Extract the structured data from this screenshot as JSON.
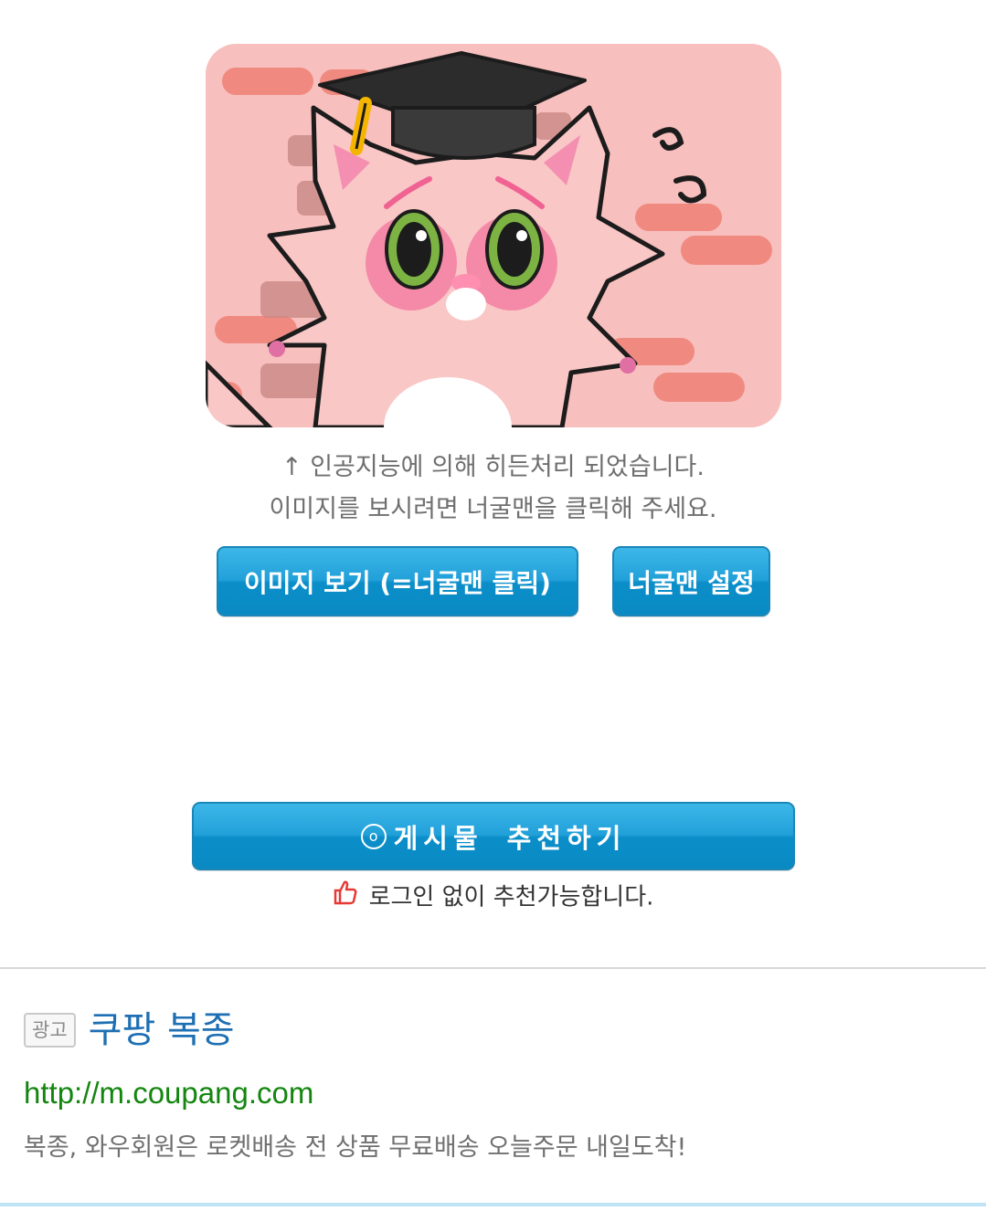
{
  "hidden_image": {
    "icon": "graduation-cat-mascot",
    "colors": {
      "background": "#f7bfbd",
      "bricks": "#f08a80",
      "cat": "#f9c7c6",
      "eyes": "#7cb342"
    }
  },
  "notice": {
    "line1": "↑ 인공지능에 의해 히든처리 되었습니다.",
    "line2": "이미지를 보시려면 너굴맨을 클릭해 주세요."
  },
  "buttons": {
    "view_image": "이미지 보기 (=너굴맨 클릭)",
    "settings": "너굴맨 설정"
  },
  "recommend": {
    "icon": "ⓞ",
    "part1": "게시물",
    "part2": "추천하기",
    "note": "로그인 없이 추천가능합니다.",
    "note_icon": "thumbs-up-icon"
  },
  "ad": {
    "badge": "광고",
    "title": "쿠팡 복종",
    "url": "http://m.coupang.com",
    "description": "복종, 와우회원은 로켓배송 전 상품 무료배송 오늘주문 내일도착!"
  },
  "colors": {
    "button_blue": "#21a0d9",
    "ad_title": "#1e6fb3",
    "ad_url": "#14860f"
  }
}
